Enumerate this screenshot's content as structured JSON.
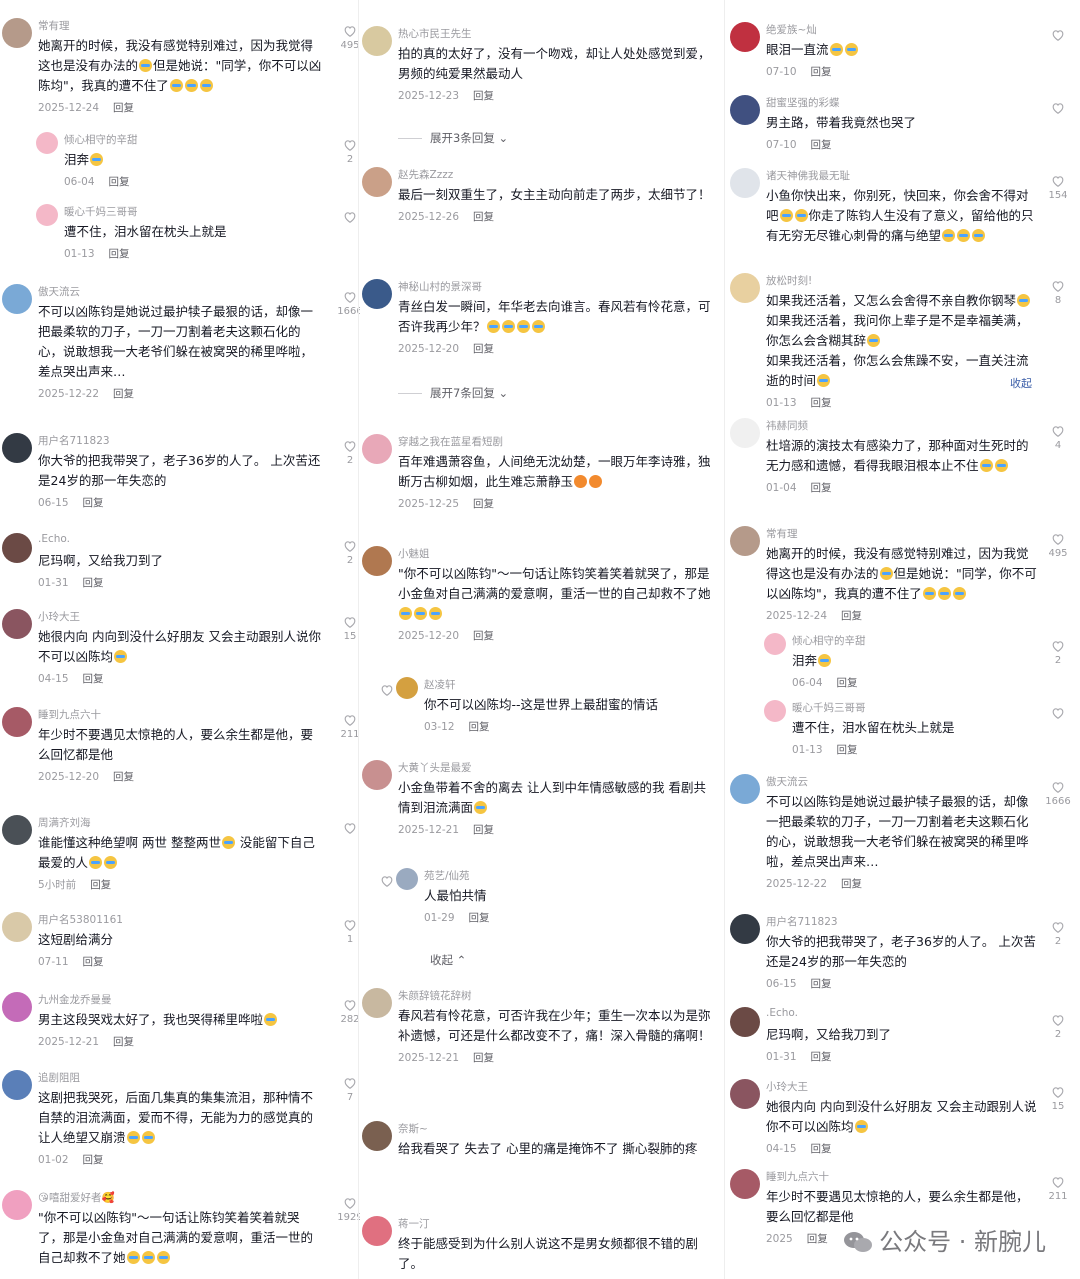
{
  "reply_label": "回复",
  "colors": {
    "heart": "#a8a8ad",
    "username": "#9a9a9f",
    "fold_link": "#3b5ea8"
  },
  "col1": [
    {
      "user": "常有理",
      "text": "她离开的时候，我没有感觉特别难过，因为我觉得这也是没有办法的😢但是她说：\"同学，你不可以凶陈均\"，我真的遭不住了😭😭😭",
      "date": "2025-12-24",
      "likes": "495",
      "avatar": "#b59a8a"
    },
    {
      "user": "倾心相守的辛甜",
      "text": "泪奔😭",
      "date": "06-04",
      "likes": "2",
      "avatar": "#f4b8c8",
      "sub": true
    },
    {
      "user": "暖心千妈三哥哥",
      "text": "遭不住，泪水留在枕头上就是",
      "date": "01-13",
      "likes": "",
      "avatar": "#f4b8c8",
      "sub": true
    },
    {
      "user": "傲天流云",
      "text": "不可以凶陈钧是她说过最护犊子最狠的话，却像一把最柔软的刀子，一刀一刀割着老夫这颗石化的心，说敢想我一大老爷们躲在被窝哭的稀里哗啦，差点哭出声来…",
      "date": "2025-12-22",
      "likes": "1666",
      "avatar": "#7aa9d6"
    },
    {
      "user": "用户名711823",
      "text": "你大爷的把我带哭了，老子36岁的人了。 上次苦还是24岁的那一年失恋的",
      "date": "06-15",
      "likes": "2",
      "avatar": "#333a44"
    },
    {
      "user": ".Echo.",
      "text": "尼玛啊，又给我刀到了",
      "date": "01-31",
      "likes": "2",
      "avatar": "#6b4a45"
    },
    {
      "user": "小玲大王",
      "text": "她很内向 内向到没什么好朋友 又会主动跟别人说你不可以凶陈均😭",
      "date": "04-15",
      "likes": "15",
      "avatar": "#8a5560"
    },
    {
      "user": "睡到九点六十",
      "text": "年少时不要遇见太惊艳的人，要么余生都是他，要么回忆都是他",
      "date": "2025-12-20",
      "likes": "211",
      "avatar": "#a65a66"
    },
    {
      "user": "周满齐刘海",
      "text": "谁能懂这种绝望啊 两世 整整两世😭 没能留下自己最爱的人😭😭",
      "date": "5小时前",
      "likes": "",
      "avatar": "#4a5056"
    },
    {
      "user": "用户名53801161",
      "text": "这短剧给满分",
      "date": "07-11",
      "likes": "1",
      "avatar": "#d9c9a8"
    },
    {
      "user": "九州金龙乔曼曼",
      "text": "男主这段哭戏太好了，我也哭得稀里哗啦😭",
      "date": "2025-12-21",
      "likes": "282",
      "avatar": "#c46bb8"
    },
    {
      "user": "追剧阻阻",
      "text": "这剧把我哭死，后面几集真的集集流泪，那种情不自禁的泪流满面，爱而不得，无能为力的感觉真的让人绝望又崩溃😭😭",
      "date": "01-02",
      "likes": "7",
      "avatar": "#5a7fb8"
    },
    {
      "user": "😘嘻甜爱好者🥰",
      "text": "\"你不可以凶陈钧\"～一句话让陈钧笑着笑着就哭了，那是小金鱼对自己满满的爱意啊，重活一世的自己却救不了她😢😢😢",
      "date": "",
      "likes": "1929",
      "avatar": "#f0a0c0"
    }
  ],
  "col2": [
    {
      "user": "热心市民王先生",
      "text": "拍的真的太好了，没有一个吻戏，却让人处处感觉到爱，男频的纯爱果然最动人",
      "date": "2025-12-23",
      "likes": "",
      "avatar": "#d8c9a0"
    },
    {
      "expand": "展开3条回复"
    },
    {
      "user": "赵先森Zzzz",
      "text": "最后一刻双重生了，女主主动向前走了两步，太细节了！",
      "date": "2025-12-26",
      "likes": "",
      "avatar": "#caa088"
    },
    {
      "user": "神秘山村的景深哥",
      "text": "青丝白发一瞬间，年华老去向谁言。春风若有怜花意，可否许我再少年？😭😭😭😭",
      "date": "2025-12-20",
      "likes": "",
      "avatar": "#3a5a8a"
    },
    {
      "expand": "展开7条回复"
    },
    {
      "user": "穿越之我在蓝星看短剧",
      "text": "百年难遇萧容鱼，人间绝无沈幼楚，一眼万年李诗雅，独断万古柳如烟，此生难忘萧静玉😍😍",
      "date": "2025-12-25",
      "likes": "",
      "avatar": "#e8a8b8"
    },
    {
      "user": "小魅姐",
      "text": "\"你不可以凶陈钧\"～一句话让陈钧笑着笑着就哭了，那是小金鱼对自己满满的爱意啊，重活一世的自己却救不了她😢😢😢",
      "date": "2025-12-20",
      "likes": "",
      "avatar": "#b07850"
    },
    {
      "user": "赵凌轩",
      "text": "你不可以凶陈均--这是世界上最甜蜜的情话",
      "date": "03-12",
      "likes": "",
      "avatar": "#d4a040",
      "sub": true
    },
    {
      "user": "大黄丫头是最爱",
      "text": "小金鱼带着不舍的离去 让人到中年情感敏感的我 看剧共情到泪流满面😂",
      "date": "2025-12-21",
      "likes": "",
      "avatar": "#c89090"
    },
    {
      "user": "苑艺/仙苑",
      "text": "人最怕共情",
      "date": "01-29",
      "likes": "",
      "avatar": "#9aaac0",
      "sub": true
    },
    {
      "fold": "收起"
    },
    {
      "user": "朱颜辞镜花辞树",
      "text": "春风若有怜花意，可否许我在少年；重生一次本以为是弥补遗憾，可还是什么都改变不了，痛！深入骨髓的痛啊！",
      "date": "2025-12-21",
      "likes": "",
      "avatar": "#c8b8a0"
    },
    {
      "user": "奈斯~",
      "text": "给我看哭了 失去了 心里的痛是掩饰不了 撕心裂肺的疼",
      "date": "",
      "likes": "",
      "avatar": "#7a6050"
    },
    {
      "user": "蒋一汀",
      "text": "终于能感受到为什么别人说这不是男女频都很不错的剧了。",
      "date": "",
      "likes": "",
      "avatar": "#e07080"
    }
  ],
  "col3": [
    {
      "user": "绝爱族~灿",
      "text": "眼泪一直流😂😭",
      "date": "07-10",
      "likes": "",
      "avatar": "#c03040"
    },
    {
      "user": "甜蜜坚强的彩蝶",
      "text": "男主路，带着我竟然也哭了",
      "date": "07-10",
      "likes": "",
      "avatar": "#405080"
    },
    {
      "user": "诸天神佛我最无耻",
      "text": "小鱼你快出来，你别死，快回来，你会舍不得对吧😢😢你走了陈钧人生没有了意义，留给他的只有无穷无尽锥心刺骨的痛与绝望😭😭😭",
      "date": "",
      "likes": "154",
      "avatar": "#e0e4ea"
    },
    {
      "user": "放松时刻!",
      "text": "如果我还活着，又怎么会舍得不亲自教你钢琴😭\n如果我还活着，我问你上辈子是不是幸福美满，你怎么会含糊其辞😭\n如果我还活着，你怎么会焦躁不安，一直关注流逝的时间😭",
      "date": "01-13",
      "likes": "8",
      "avatar": "#e8d0a0",
      "fold": "收起"
    },
    {
      "user": "祎赫同频",
      "text": "杜培源的演技太有感染力了，那种面对生死时的无力感和遗憾，看得我眼泪根本止不住😭😭",
      "date": "01-04",
      "likes": "4",
      "avatar": "#f0f0f0"
    },
    {
      "user": "常有理",
      "text": "她离开的时候，我没有感觉特别难过，因为我觉得这也是没有办法的😢但是她说：\"同学，你不可以凶陈均\"，我真的遭不住了😭😭😭",
      "date": "2025-12-24",
      "likes": "495",
      "avatar": "#b59a8a"
    },
    {
      "user": "倾心相守的辛甜",
      "text": "泪奔😭",
      "date": "06-04",
      "likes": "2",
      "avatar": "#f4b8c8",
      "sub": true
    },
    {
      "user": "暖心千妈三哥哥",
      "text": "遭不住，泪水留在枕头上就是",
      "date": "01-13",
      "likes": "",
      "avatar": "#f4b8c8",
      "sub": true
    },
    {
      "user": "傲天流云",
      "text": "不可以凶陈钧是她说过最护犊子最狠的话，却像一把最柔软的刀子，一刀一刀割着老夫这颗石化的心，说敢想我一大老爷们躲在被窝哭的稀里哗啦，差点哭出声来…",
      "date": "2025-12-22",
      "likes": "1666",
      "avatar": "#7aa9d6"
    },
    {
      "user": "用户名711823",
      "text": "你大爷的把我带哭了，老子36岁的人了。 上次苦还是24岁的那一年失恋的",
      "date": "06-15",
      "likes": "2",
      "avatar": "#333a44"
    },
    {
      "user": ".Echo.",
      "text": "尼玛啊，又给我刀到了",
      "date": "01-31",
      "likes": "2",
      "avatar": "#6b4a45"
    },
    {
      "user": "小玲大王",
      "text": "她很内向 内向到没什么好朋友 又会主动跟别人说你不可以凶陈均😭",
      "date": "04-15",
      "likes": "15",
      "avatar": "#8a5560"
    },
    {
      "user": "睡到九点六十",
      "text": "年少时不要遇见太惊艳的人，要么余生都是他，要么回忆都是他",
      "date": "2025",
      "likes": "211",
      "avatar": "#a65a66"
    }
  ],
  "watermark": "公众号 · 新腕儿"
}
